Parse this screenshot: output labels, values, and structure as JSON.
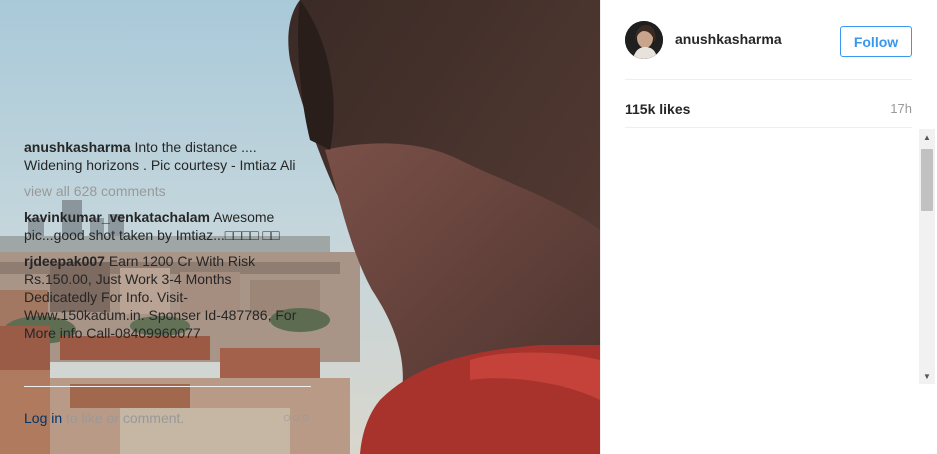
{
  "post": {
    "username": "anushkasharma",
    "follow_label": "Follow",
    "likes": "115k likes",
    "time": "17h",
    "view_all": "view all 628 comments",
    "login_link": "Log in",
    "login_suffix": " to like or comment.",
    "more": "○○○"
  },
  "comments": [
    {
      "author": "anushkasharma",
      "text": "Into the distance .... Widening horizons . Pic courtesy - Imtiaz Ali"
    },
    {
      "author": "kavinkumar_venkatachalam",
      "text": "Awesome pic...good shot taken by Imtiaz...□□□□ □□"
    },
    {
      "author": "rjdeepak007",
      "text": "Earn 1200 Cr With Risk Rs.150.00, Just Work 3-4 Months Dedicatedly For Info. Visit- Www.150kadum.in.  Sponser Id-487786, For More info Call-08409960077"
    }
  ],
  "scrollbar": {
    "up": "▲",
    "down": "▼"
  },
  "colors": {
    "accent": "#3897f0",
    "link": "#003569",
    "muted": "#999999"
  }
}
